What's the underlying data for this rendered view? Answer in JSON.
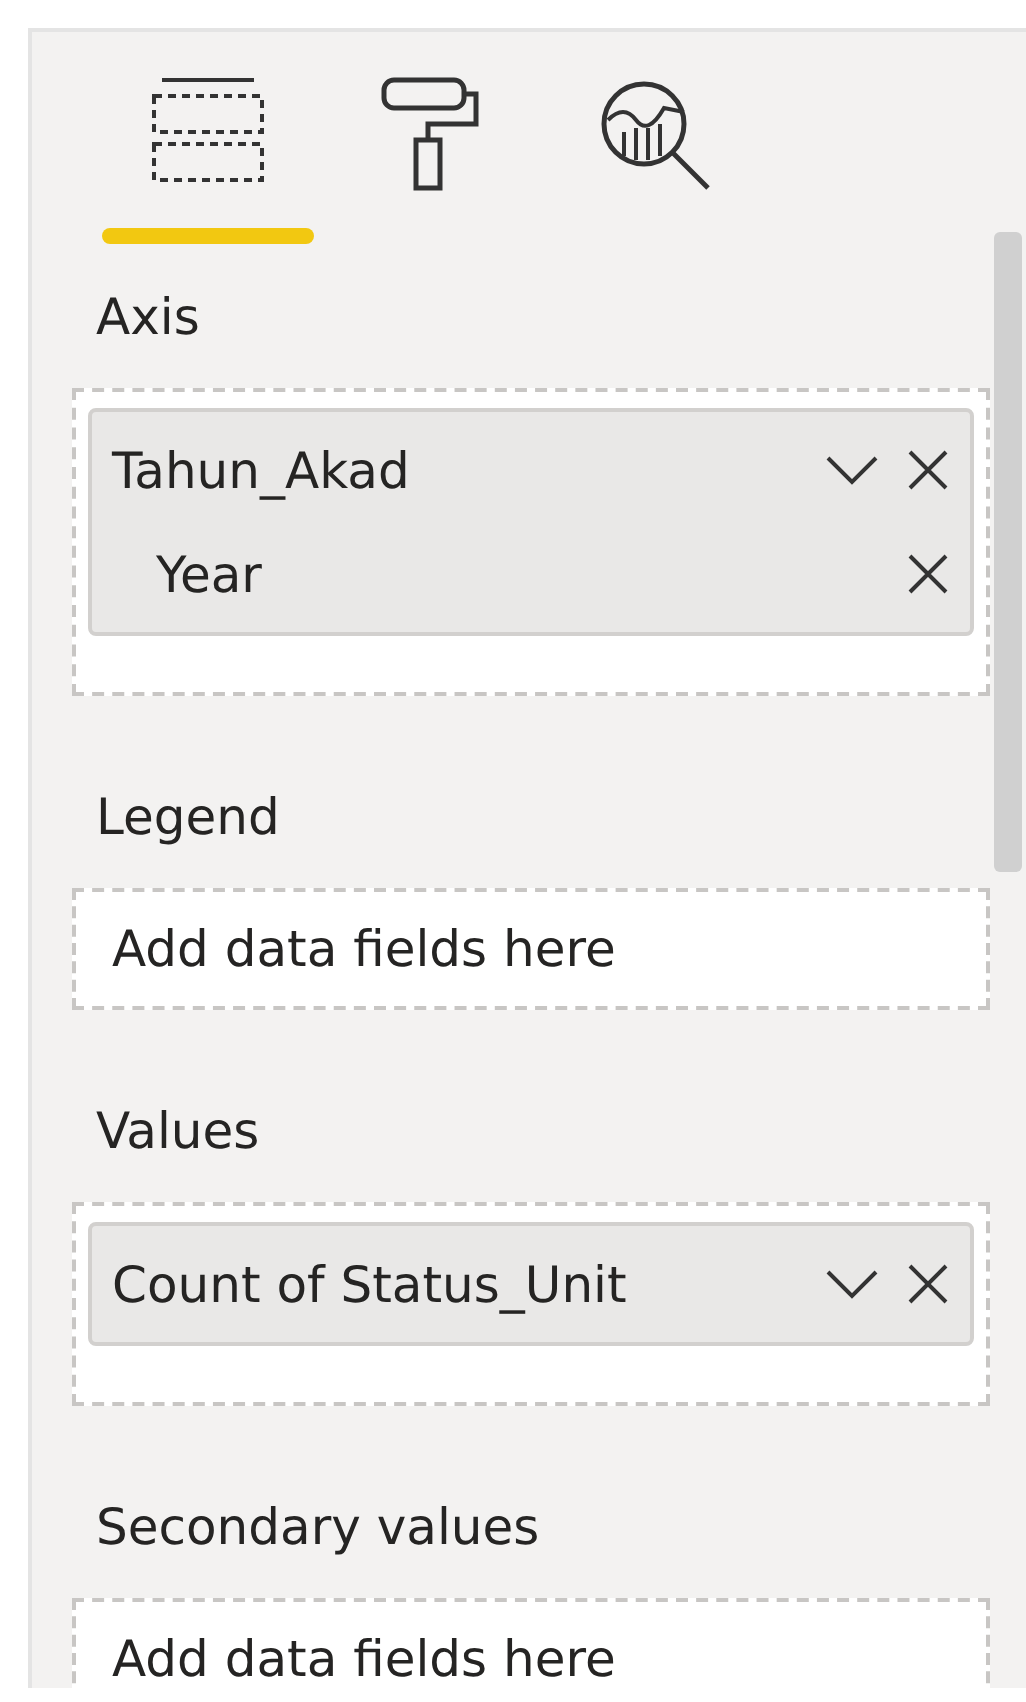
{
  "tabs": [
    {
      "kind": "fields",
      "selected": true
    },
    {
      "kind": "format",
      "selected": false
    },
    {
      "kind": "analytics",
      "selected": false
    }
  ],
  "sections": [
    {
      "title": "Axis",
      "fields": [
        {
          "name": "Tahun_Akad",
          "menu": true,
          "children": [
            {
              "name": "Year",
              "menu": false
            }
          ]
        }
      ]
    },
    {
      "title": "Legend",
      "placeholder": "Add data fields here"
    },
    {
      "title": "Values",
      "fields": [
        {
          "name": "Count of Status_Unit",
          "menu": true
        }
      ]
    },
    {
      "title": "Secondary values",
      "placeholder": "Add data fields here"
    }
  ]
}
